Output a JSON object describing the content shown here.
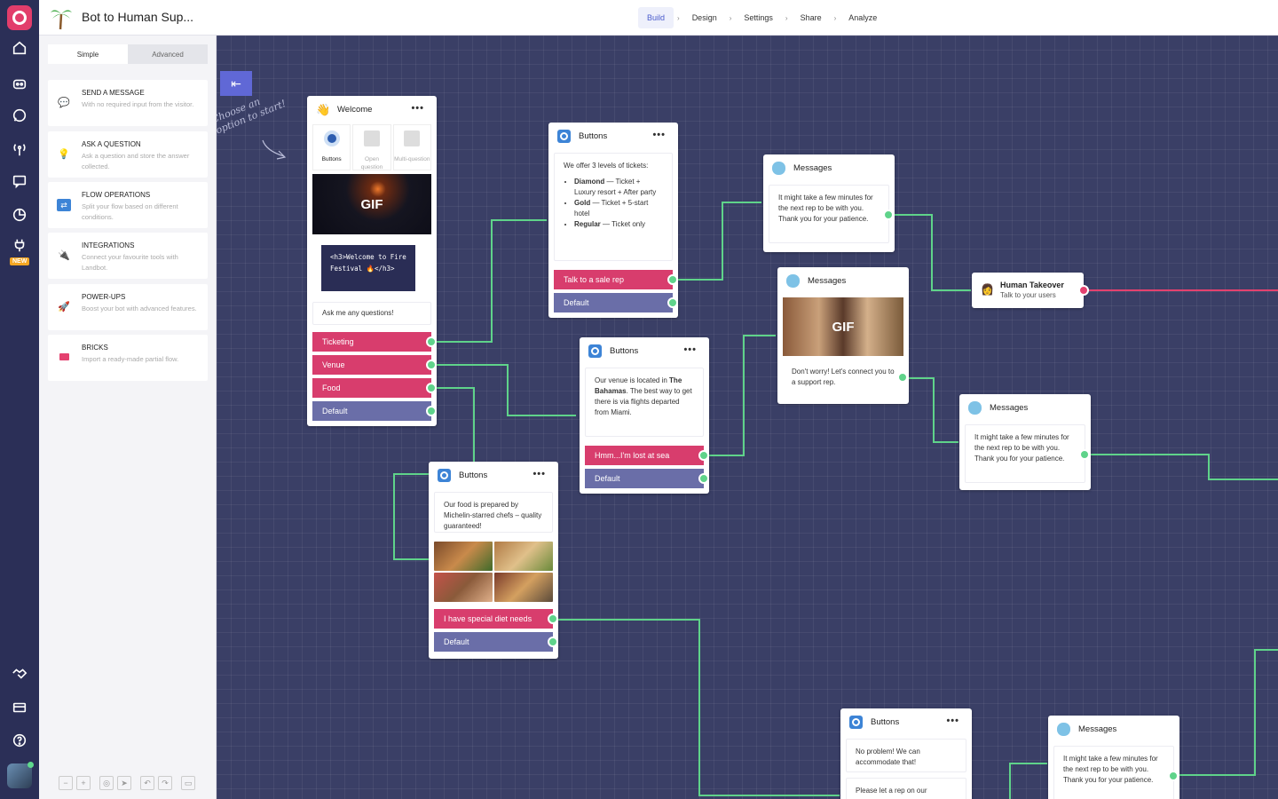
{
  "app": {
    "title": "Bot to Human Sup...",
    "new_badge": "NEW"
  },
  "nav": {
    "steps": [
      "Build",
      "Design",
      "Settings",
      "Share",
      "Analyze"
    ],
    "separator": "›"
  },
  "panel": {
    "tabs": [
      "Simple",
      "Advanced"
    ],
    "cards": [
      {
        "title": "SEND A MESSAGE",
        "desc": "With no required input from the visitor."
      },
      {
        "title": "ASK A QUESTION",
        "desc": "Ask a question and store the answer collected."
      },
      {
        "title": "FLOW OPERATIONS",
        "desc": "Split your flow based on different conditions."
      },
      {
        "title": "INTEGRATIONS",
        "desc": "Connect your favourite tools with Landbot."
      },
      {
        "title": "POWER-UPS",
        "desc": "Boost your bot with advanced features."
      },
      {
        "title": "BRICKS",
        "desc": "Import a ready-made partial flow."
      }
    ],
    "zoom": [
      "−",
      "+",
      "◎",
      "➤",
      "↶",
      "↷",
      "▭"
    ]
  },
  "canvas": {
    "collapse": "⇤",
    "hint": "Choose an option to start!",
    "welcome": {
      "title": "Welcome",
      "dots": "•••",
      "options": [
        "Buttons",
        "Open question",
        "Multi-question"
      ],
      "gif": "GIF",
      "code": "<h3>Welcome to Fire Festival 🔥</h3>",
      "ask": "Ask me any questions!",
      "buttons": [
        "Ticketing",
        "Venue",
        "Food",
        "Default"
      ]
    },
    "buttons1": {
      "title": "Buttons",
      "dots": "•••",
      "intro": "We offer 3 levels of tickets:",
      "items": [
        {
          "b": "Diamond",
          "t": " — Ticket + Luxury resort + After party"
        },
        {
          "b": "Gold",
          "t": " — Ticket + 5-start hotel"
        },
        {
          "b": "Regular",
          "t": " — Ticket only"
        }
      ],
      "buttons": [
        "Talk to a sale rep",
        "Default"
      ]
    },
    "buttons2": {
      "title": "Buttons",
      "dots": "•••",
      "text_a": "Our venue is located in ",
      "text_b": "The Bahamas",
      "text_c": ". The best way to get there is via flights departed from Miami.",
      "buttons": [
        "Hmm...I'm lost at sea",
        "Default"
      ]
    },
    "buttons3": {
      "title": "Buttons",
      "dots": "•••",
      "text": "Our food is prepared by Michelin-starred chefs – quality guaranteed!",
      "buttons": [
        "I have special diet needs",
        "Default"
      ]
    },
    "buttons4": {
      "title": "Buttons",
      "dots": "•••",
      "text": "No problem! We can accommodate that!",
      "text2": "Please let a rep on our"
    },
    "msg1": {
      "title": "Messages",
      "text": "It might take a few minutes for the next rep to be with you. Thank you for your patience."
    },
    "msg2": {
      "title": "Messages",
      "gif": "GIF",
      "text": "Don't worry! Let's connect you to a support rep."
    },
    "msg3": {
      "title": "Messages",
      "text": "It might take a few minutes for the next rep to be with you. Thank you for your patience."
    },
    "msg4": {
      "title": "Messages",
      "text": "It might take a few minutes for the next rep to be with you. Thank you for your patience."
    },
    "human": {
      "title": "Human Takeover",
      "sub": "Talk to your users"
    }
  },
  "colors": {
    "rail": "#2b2f57",
    "canvas": "#3a3f66",
    "accent": "#4b5ccc",
    "pink": "#d83d6d",
    "default": "#6a6ea8",
    "wire": "#5fd38a",
    "human_wire": "#e4416f"
  }
}
